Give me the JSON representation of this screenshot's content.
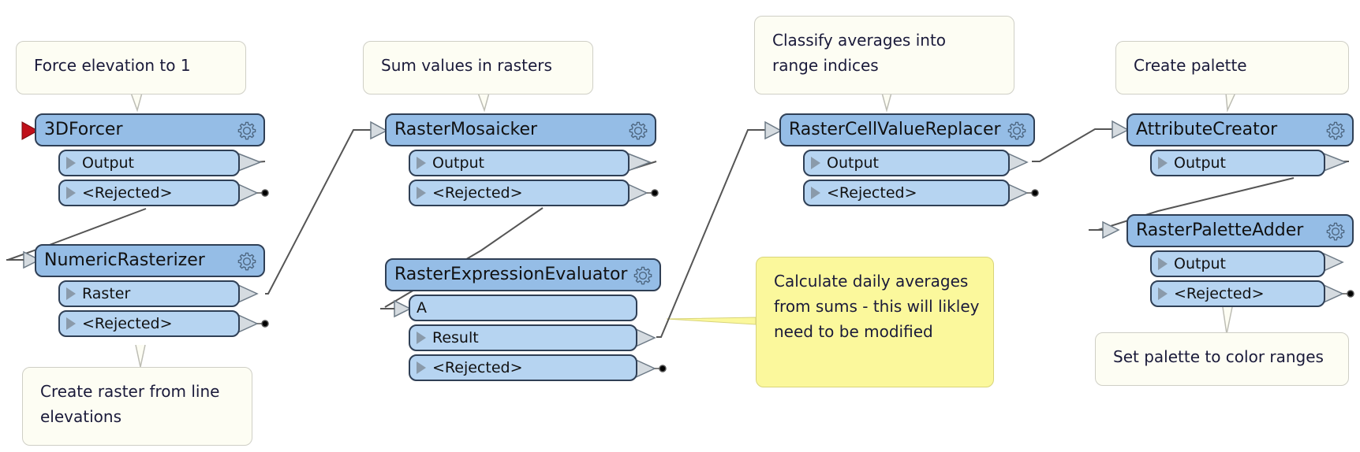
{
  "annotations": [
    {
      "id": "force-elevation",
      "text": "Force elevation to 1"
    },
    {
      "id": "create-raster",
      "text": "Create raster from line elevations"
    },
    {
      "id": "sum-values",
      "text": "Sum values in rasters"
    },
    {
      "id": "classify-averages",
      "text": "Classify averages into range indices"
    },
    {
      "id": "calculate-averages",
      "text": "Calculate daily averages from sums - this will likley need to be modified"
    },
    {
      "id": "create-palette",
      "text": "Create palette"
    },
    {
      "id": "set-palette",
      "text": "Set palette to color ranges"
    }
  ],
  "transformers": [
    {
      "name": "3DForcer",
      "ports": [
        "Output",
        "<Rejected>"
      ]
    },
    {
      "name": "NumericRasterizer",
      "ports": [
        "Raster",
        "<Rejected>"
      ]
    },
    {
      "name": "RasterMosaicker",
      "ports": [
        "Output",
        "<Rejected>"
      ]
    },
    {
      "name": "RasterExpressionEvaluator",
      "input": "A",
      "ports": [
        "Result",
        "<Rejected>"
      ]
    },
    {
      "name": "RasterCellValueReplacer",
      "ports": [
        "Output",
        "<Rejected>"
      ]
    },
    {
      "name": "AttributeCreator",
      "ports": [
        "Output"
      ]
    },
    {
      "name": "RasterPaletteAdder",
      "ports": [
        "Output",
        "<Rejected>"
      ]
    }
  ],
  "colors": {
    "header": "#95bde6",
    "port": "#b6d4f1",
    "border": "#2f3f55",
    "annotation": "#fdfdf3",
    "annotation_highlight": "#fbf89c",
    "source_marker": "#c0101a",
    "wire": "#555555"
  }
}
